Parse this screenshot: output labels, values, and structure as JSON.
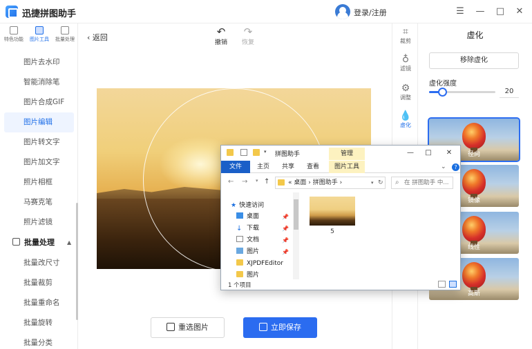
{
  "app": {
    "title": "迅捷拼图助手",
    "login": "登录/注册",
    "window_buttons": [
      "☰",
      "—",
      "□",
      "✕"
    ]
  },
  "left_nav": {
    "top_tabs": [
      {
        "label": "特色功能",
        "active": false
      },
      {
        "label": "图片工具",
        "active": true
      },
      {
        "label": "批量处理",
        "active": false
      }
    ],
    "items": [
      {
        "label": "图片去水印",
        "active": false
      },
      {
        "label": "智能消除笔",
        "active": false
      },
      {
        "label": "图片合成GIF",
        "active": false
      },
      {
        "label": "图片编辑",
        "active": true
      },
      {
        "label": "图片转文字",
        "active": false
      },
      {
        "label": "图片加文字",
        "active": false
      },
      {
        "label": "照片相框",
        "active": false
      },
      {
        "label": "马赛克笔",
        "active": false
      },
      {
        "label": "照片滤镜",
        "active": false
      }
    ],
    "section": {
      "label": "批量处理",
      "chevron": "▲"
    },
    "batch_items": [
      "批量改尺寸",
      "批量裁剪",
      "批量重命名",
      "批量旋转",
      "批量分类"
    ]
  },
  "editor": {
    "back_label": "返回",
    "undo_label": "撤销",
    "redo_label": "恢复",
    "reselect_label": "重选图片",
    "save_label": "立即保存"
  },
  "tools": [
    {
      "label": "裁剪",
      "glyph": "⌗",
      "active": false
    },
    {
      "label": "滤镜",
      "glyph": "♁",
      "active": false
    },
    {
      "label": "调整",
      "glyph": "⚙",
      "active": false
    },
    {
      "label": "虚化",
      "glyph": "💧",
      "active": true
    }
  ],
  "blur_panel": {
    "title": "虚化",
    "remove_label": "移除虚化",
    "strength_label": "虚化强度",
    "strength_value": "20",
    "strength_fraction": 0.2,
    "effects": [
      {
        "label": "径向",
        "selected": true
      },
      {
        "label": "镜像",
        "selected": false
      },
      {
        "label": "线性",
        "selected": false
      },
      {
        "label": "高斯",
        "selected": false
      }
    ]
  },
  "explorer": {
    "title": "拼图助手",
    "manage_label": "管理",
    "tabs": [
      "文件",
      "主页",
      "共享",
      "查看",
      "图片工具"
    ],
    "window_buttons": [
      "—",
      "□",
      "✕"
    ],
    "help": "?",
    "address": [
      "«",
      "桌面",
      "›",
      "拼图助手",
      "›"
    ],
    "search_placeholder": "在 拼图助手 中...",
    "tree": [
      {
        "label": "快速访问",
        "pinned": false
      },
      {
        "label": "桌面",
        "pinned": true
      },
      {
        "label": "下载",
        "pinned": true
      },
      {
        "label": "文档",
        "pinned": true
      },
      {
        "label": "图片",
        "pinned": true
      },
      {
        "label": "XJPDFEditor",
        "pinned": false
      },
      {
        "label": "图片",
        "pinned": false
      }
    ],
    "file_name": "5",
    "status": "1 个项目"
  },
  "colors": {
    "accent": "#2b6cf0",
    "explorer_file_tab": "#1a5fc8",
    "manage_bg": "#fdf2c0"
  }
}
